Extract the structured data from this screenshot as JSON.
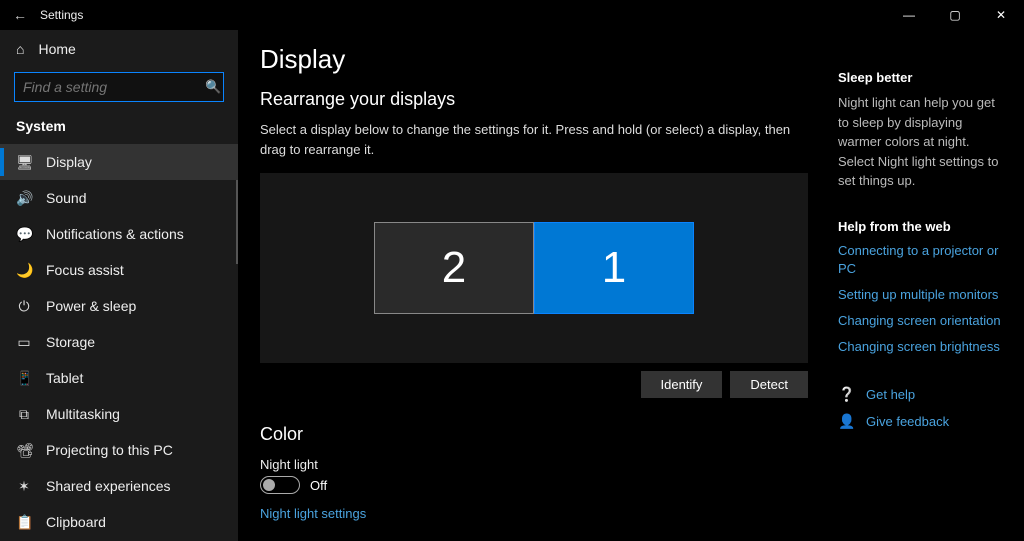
{
  "window": {
    "title": "Settings",
    "min": "—",
    "max": "▢",
    "close": "✕"
  },
  "sidebar": {
    "home": "Home",
    "search_placeholder": "Find a setting",
    "category": "System",
    "items": [
      {
        "icon": "🖥",
        "label": "Display",
        "selected": true
      },
      {
        "icon": "🔊",
        "label": "Sound"
      },
      {
        "icon": "💬",
        "label": "Notifications & actions"
      },
      {
        "icon": "🌙",
        "label": "Focus assist"
      },
      {
        "icon": "⏻",
        "label": "Power & sleep"
      },
      {
        "icon": "▭",
        "label": "Storage"
      },
      {
        "icon": "📱",
        "label": "Tablet"
      },
      {
        "icon": "⧉",
        "label": "Multitasking"
      },
      {
        "icon": "📽",
        "label": "Projecting to this PC"
      },
      {
        "icon": "✶",
        "label": "Shared experiences"
      },
      {
        "icon": "📋",
        "label": "Clipboard"
      }
    ]
  },
  "page": {
    "title": "Display",
    "rearrange_heading": "Rearrange your displays",
    "rearrange_desc": "Select a display below to change the settings for it. Press and hold (or select) a display, then drag to rearrange it.",
    "monitors": {
      "left": "2",
      "right": "1"
    },
    "identify": "Identify",
    "detect": "Detect",
    "color_heading": "Color",
    "night_light_label": "Night light",
    "night_light_state": "Off",
    "night_light_link": "Night light settings"
  },
  "aside": {
    "sleep_title": "Sleep better",
    "sleep_body": "Night light can help you get to sleep by displaying warmer colors at night. Select Night light settings to set things up.",
    "help_title": "Help from the web",
    "links": [
      "Connecting to a projector or PC",
      "Setting up multiple monitors",
      "Changing screen orientation",
      "Changing screen brightness"
    ],
    "get_help": "Get help",
    "give_feedback": "Give feedback"
  }
}
